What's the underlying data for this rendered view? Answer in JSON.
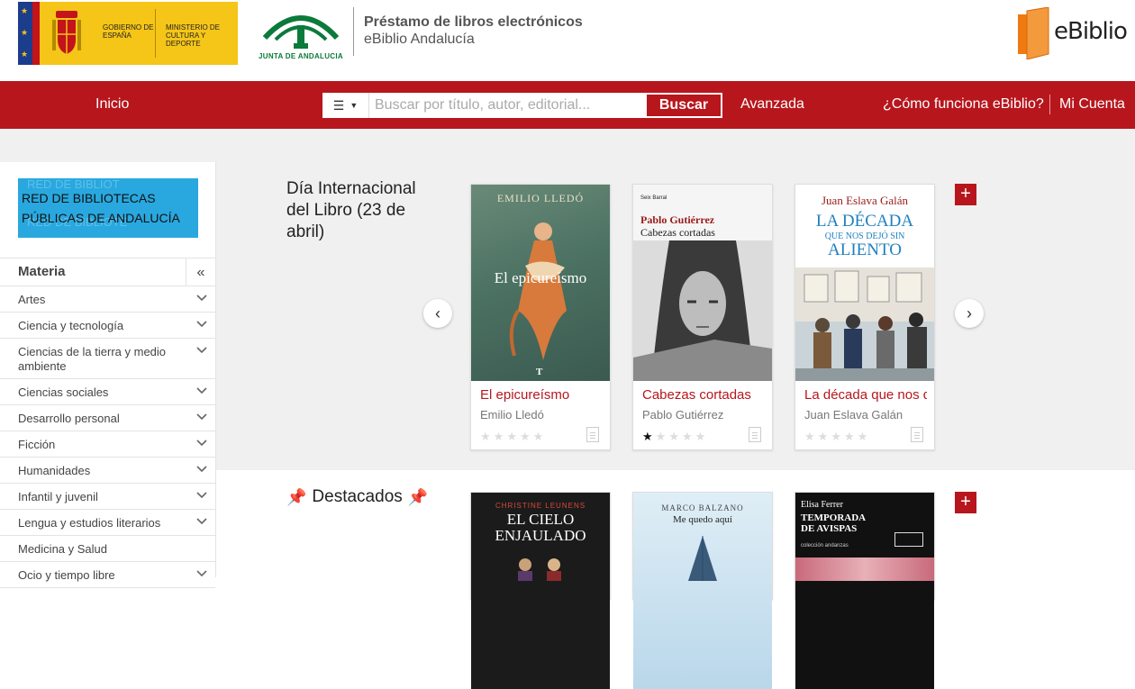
{
  "header": {
    "gov_text1": "Gobierno de España",
    "gov_text2": "Ministerio de Cultura y Deporte",
    "junta_text": "JUNTA DE ANDALUCIA",
    "site_title": "Préstamo de libros electrónicos",
    "site_subtitle": "eBiblio Andalucía",
    "brand_logo": "eBiblio"
  },
  "nav": {
    "home": "Inicio",
    "search_placeholder": "Buscar por título, autor, editorial...",
    "search_button": "Buscar",
    "advanced": "Avanzada",
    "how_it_works": "¿Cómo funciona eBiblio?",
    "account": "Mi Cuenta"
  },
  "sidebar": {
    "banner_line1": "RED DE BIBLIOTECAS",
    "banner_line2": "PÚBLICAS DE ANDALUCÍA",
    "materia_title": "Materia",
    "collapse_glyph": "«",
    "categories": [
      {
        "label": "Artes"
      },
      {
        "label": "Ciencia y tecnología"
      },
      {
        "label": "Ciencias de la tierra y medio ambiente"
      },
      {
        "label": "Ciencias sociales"
      },
      {
        "label": "Desarrollo personal"
      },
      {
        "label": "Ficción"
      },
      {
        "label": "Humanidades"
      },
      {
        "label": "Infantil y juvenil"
      },
      {
        "label": "Lengua y estudios literarios"
      },
      {
        "label": "Medicina y Salud"
      },
      {
        "label": "Ocio y tiempo libre"
      }
    ]
  },
  "sections": [
    {
      "title": "Día Internacional del Libro (23 de abril)",
      "books": [
        {
          "cover_author": "EMILIO LLEDÓ",
          "cover_title": "El epicureísmo",
          "title": "El epicureísmo",
          "author": "Emilio Lledó",
          "rating": 0
        },
        {
          "cover_author": "Pablo Gutiérrez",
          "cover_title": "Cabezas cortadas",
          "cover_publisher": "Seix Barral",
          "title": "Cabezas cortadas",
          "author": "Pablo Gutiérrez",
          "rating": 1
        },
        {
          "cover_author": "Juan Eslava Galán",
          "cover_title_1": "LA DÉCADA",
          "cover_title_2": "QUE NOS DEJÓ SIN",
          "cover_title_3": "ALIENTO",
          "title": "La década que nos dejó sin aliento",
          "author": "Juan Eslava Galán",
          "rating": 0
        }
      ]
    },
    {
      "title": "Destacados",
      "books": [
        {
          "cover_author": "CHRISTINE LEUNENS",
          "cover_title_1": "EL CIELO",
          "cover_title_2": "ENJAULADO"
        },
        {
          "cover_author": "MARCO BALZANO",
          "cover_title": "Me quedo aquí"
        },
        {
          "cover_author": "Elisa Ferrer",
          "cover_title_1": "TEMPORADA",
          "cover_title_2": "DE AVISPAS",
          "cover_collection": "colección andanzas"
        }
      ]
    }
  ],
  "controls": {
    "prev": "‹",
    "next": "›",
    "plus": "+",
    "star": "★"
  },
  "colors": {
    "brand_red": "#b7161d",
    "gov_yellow": "#f5c518",
    "junta_green": "#0b7a3b",
    "ebiblio_orange": "#f07a12"
  }
}
